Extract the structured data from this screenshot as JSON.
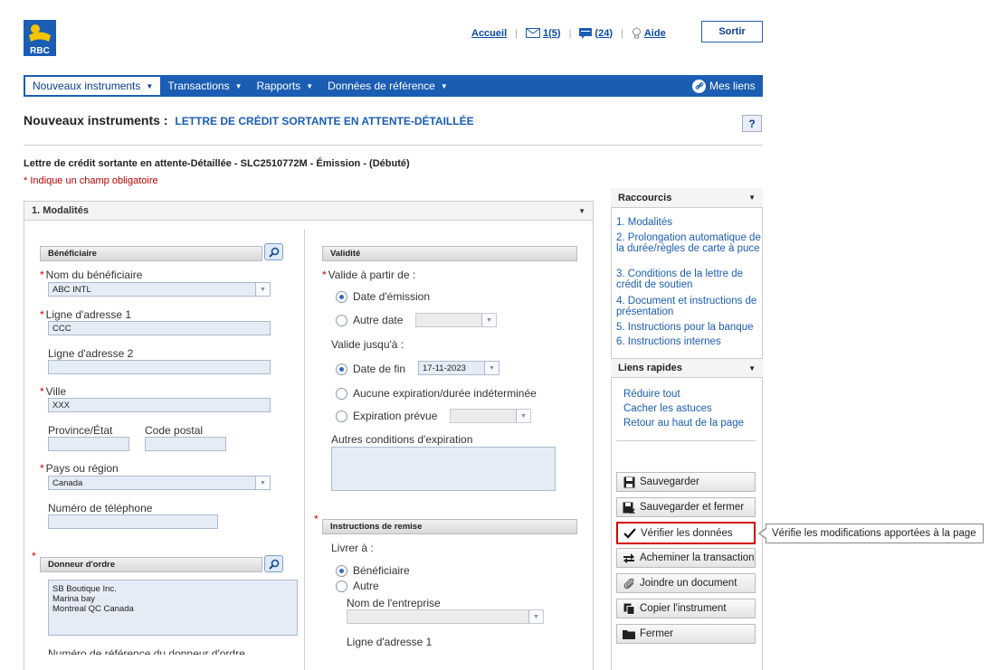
{
  "header": {
    "brand": "RBC",
    "home": "Accueil",
    "messages": "1(5)",
    "notes": "(24)",
    "help": "Aide",
    "exit": "Sortir"
  },
  "menu": [
    {
      "label": "Nouveaux instruments"
    },
    {
      "label": "Transactions"
    },
    {
      "label": "Rapports"
    },
    {
      "label": "Données de référence"
    }
  ],
  "mes_liens": "Mes liens",
  "page": {
    "title": "Nouveaux instruments :",
    "subtitle": "LETTRE DE CRÉDIT SORTANTE EN ATTENTE-DÉTAILLÉE",
    "help_button": "?",
    "record": "Lettre de crédit sortante en attente-Détaillée - SLC2510772M - Émission - (Débuté)",
    "required_note": "* Indique un champ obligatoire"
  },
  "section": {
    "title": "1. Modalités"
  },
  "beneficiary": {
    "group": "Bénéficiaire",
    "name_label": "Nom du bénéficiaire",
    "name_value": "ABC INTL",
    "addr1_label": "Ligne d'adresse 1",
    "addr1_value": "CCC",
    "addr2_label": "Ligne d'adresse 2",
    "addr2_value": "",
    "city_label": "Ville",
    "city_value": "XXX",
    "province_label": "Province/État",
    "postal_label": "Code postal",
    "country_label": "Pays ou région",
    "country_value": "Canada",
    "phone_label": "Numéro de téléphone"
  },
  "orderer": {
    "group": "Donneur d'ordre",
    "lines": [
      "SB Boutique Inc.",
      "Marina bay",
      "Montreal QC Canada"
    ],
    "next_label": "Numéro de référence du donneur d'ordre"
  },
  "validity": {
    "group": "Validité",
    "from_label": "Valide à partir de :",
    "opt_issue": "Date d'émission",
    "opt_other": "Autre date",
    "until_label": "Valide jusqu'à :",
    "opt_end": "Date de fin",
    "end_value": "17-11-2023",
    "opt_none": "Aucune expiration/durée indéterminée",
    "opt_expected": "Expiration prévue",
    "other_conditions_label": "Autres conditions d'expiration"
  },
  "remittance": {
    "group": "Instructions de remise",
    "deliver_label": "Livrer à :",
    "opt_beneficiary": "Bénéficiaire",
    "opt_other": "Autre",
    "company_label": "Nom de l'entreprise",
    "addr1_label": "Ligne d'adresse 1"
  },
  "shortcuts": {
    "title": "Raccourcis",
    "items": [
      "1. Modalités",
      "2. Prolongation automatique de la durée/règles de carte à puce",
      "3. Conditions de la lettre de crédit de soutien",
      "4. Document et instructions de présentation",
      "5. Instructions pour la banque",
      "6. Instructions internes"
    ]
  },
  "quicklinks": {
    "title": "Liens rapides",
    "items": [
      "Réduire tout",
      "Cacher les astuces",
      "Retour au haut de la page"
    ]
  },
  "actions": [
    {
      "label": "Sauvegarder",
      "icon": "save-icon"
    },
    {
      "label": "Sauvegarder et fermer",
      "icon": "save-close-icon"
    },
    {
      "label": "Vérifier les données",
      "icon": "check-icon"
    },
    {
      "label": "Acheminer la transaction",
      "icon": "route-icon"
    },
    {
      "label": "Joindre un document",
      "icon": "paperclip-icon"
    },
    {
      "label": "Copier l'instrument",
      "icon": "copy-icon"
    },
    {
      "label": "Fermer",
      "icon": "folder-icon"
    }
  ],
  "tooltip": "Vérifie les modifications apportées à la page",
  "colors": {
    "brand_blue": "#1b5db3",
    "highlight": "#d40000",
    "required": "#cc0000"
  }
}
